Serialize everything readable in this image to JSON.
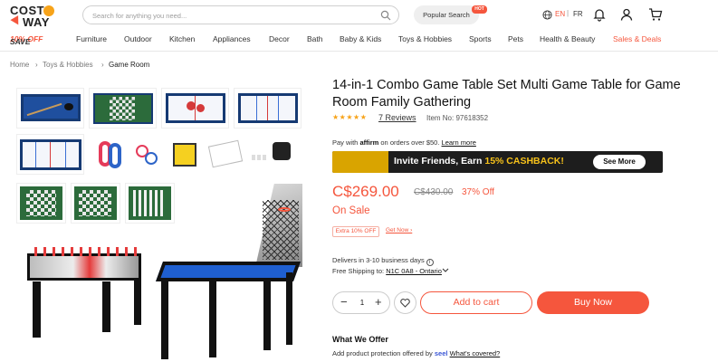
{
  "header": {
    "logo_line1": "COST",
    "logo_line2": "WAY",
    "search_placeholder": "Search for anything you need...",
    "popular_label": "Popular Search",
    "hot_badge": "HOT",
    "lang_en": "EN",
    "lang_sep": "|",
    "lang_fr": "FR",
    "icons": [
      "search-icon",
      "globe-icon",
      "bell-icon",
      "user-icon",
      "cart-icon"
    ]
  },
  "nav": {
    "save_prefix": "SAVE ",
    "save_pct": "10% OFF",
    "items": [
      "Furniture",
      "Outdoor",
      "Kitchen",
      "Appliances",
      "Decor",
      "Bath",
      "Baby & Kids",
      "Toys & Hobbies",
      "Sports",
      "Pets",
      "Health & Beauty",
      "Sales & Deals"
    ]
  },
  "breadcrumb": {
    "items": [
      "Home",
      "Toys & Hobbies",
      "Game Room"
    ],
    "sep": "›"
  },
  "product": {
    "title": "14-in-1 Combo Game Table Set Multi Game Table for Game Room Family Gathering",
    "stars": "★★★★★",
    "rating": 5,
    "reviews": "7 Reviews",
    "item_no": "Item No: 97618352",
    "pay_prefix": "Pay with",
    "affirm": "affirm",
    "pay_suffix": "on orders over $50.",
    "learn_more": "Learn more",
    "banner_msg_prefix": "Invite Friends, Earn ",
    "banner_msg_highlight": "15% CASHBACK!",
    "banner_more": "See More",
    "price": "C$269.00",
    "was_price": "C$430.00",
    "discount": "37% Off",
    "on_sale": "On Sale",
    "extra_coupon": "Extra 10% OFF",
    "get_now": "Get Now ›",
    "delivers": "Delivers in 3-10 business days",
    "shipping_prefix": "Free Shipping to: ",
    "shipping_location": "N1C 0A8 - Ontario",
    "qty_minus": "−",
    "qty_value": "1",
    "qty_plus": "+",
    "add_to_cart": "Add to cart",
    "buy_now": "Buy Now",
    "what_we_offer": "What We Offer",
    "protection_prefix": "Add product protection offered by",
    "seel": "seel",
    "whats_covered": "What's covered?"
  },
  "colors": {
    "accent": "#f5563d",
    "star": "#f7a319",
    "table_blue": "#1f4f9e"
  }
}
